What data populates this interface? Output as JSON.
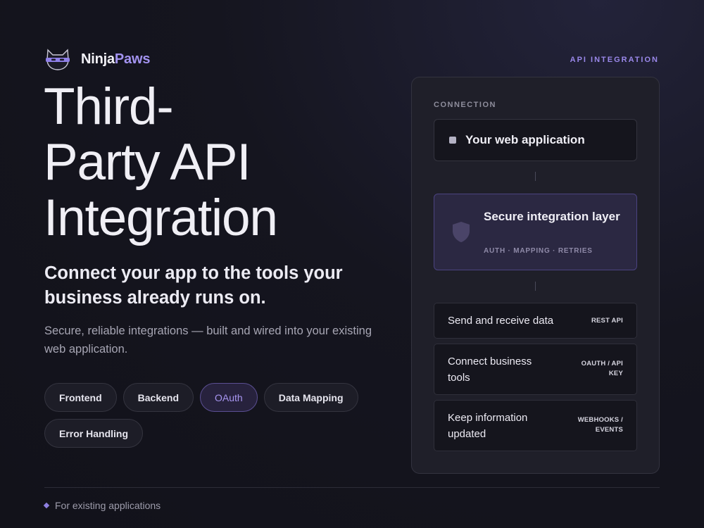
{
  "brand": {
    "name_part1": "Ninja",
    "name_part2": "Paws",
    "logo_icon": "ninja-cat-icon"
  },
  "header": {
    "tag": "API INTEGRATION"
  },
  "hero": {
    "title_line1": "Third-",
    "title_line2": "Party API",
    "title_line3": "Integration",
    "subtitle": "Connect your app to the tools your business already runs on.",
    "description": "Secure, reliable integrations — built and wired into your existing web application."
  },
  "chips": [
    {
      "label": "Frontend",
      "active": false
    },
    {
      "label": "Backend",
      "active": false
    },
    {
      "label": "OAuth",
      "active": true
    },
    {
      "label": "Data Mapping",
      "active": false
    },
    {
      "label": "Error Handling",
      "active": false
    }
  ],
  "panel": {
    "label": "CONNECTION",
    "app_box": {
      "label": "Your web application"
    },
    "layer_box": {
      "title": "Secure integration layer",
      "meta": "AUTH · MAPPING · RETRIES",
      "icon": "shield-icon"
    },
    "rows": [
      {
        "label": "Send and receive data",
        "tag": "REST API"
      },
      {
        "label": "Connect business tools",
        "tag": "OAUTH / API KEY"
      },
      {
        "label": "Keep information updated",
        "tag": "WEBHOOKS / EVENTS"
      }
    ]
  },
  "footer": {
    "text": "For existing applications"
  },
  "colors": {
    "accent": "#a393f0",
    "background": "#13131b",
    "panel": "#1f1f29"
  }
}
